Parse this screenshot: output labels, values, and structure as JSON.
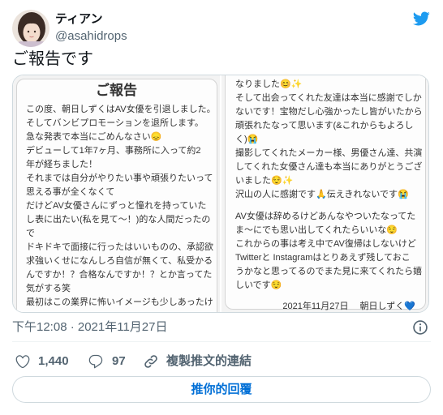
{
  "author": {
    "name": "ティアン",
    "handle": "@asahidrops"
  },
  "tweet": {
    "text": "ご報告です"
  },
  "media": {
    "left": {
      "title": "ご報告",
      "lines": [
        "この度、朝日しずくはAV女優を引退しました。",
        "そしてバンビプロモーションを退所します。",
        "急な発表で本当にごめんなさい😞",
        "デビューして1年7ヶ月、事務所に入って約2",
        "年が経ちました！",
        "それまでは自分がやりたい事や頑張りたいって",
        "思える事が全くなくて",
        "だけどAV女優さんにずっと憧れを持っていた",
        "し表に出たい(私を見て〜！)的な人間だったの",
        "で",
        "ドキドキで面接に行ったはいいものの、承認欲",
        "求強いくせになんしろ自信が無くて、私受かる",
        "んですか！？合格なんですか！？とか言ってた",
        "気がする笑",
        "最初はこの業界に怖いイメージも少しあったけ"
      ]
    },
    "right": {
      "lines": [
        "なりました😊✨",
        "そして出会ってくれた友達は本当に感謝でしか",
        "ないです！宝物だし心強かったし皆がいたから",
        "頑張れたなって思います(&これからもよろし",
        "く)😭",
        "撮影してくれたメーカー様、男優さん達、共演",
        "してくれた女優さん達も本当にありがとうござ",
        "いました😌✨",
        "沢山の人に感謝です🙏伝えきれないです😭",
        "AV女優は辞めるけどあんなやついたなってた",
        "ま〜にでも思い出してくれたらいいな😌",
        "これからの事は考え中でAV復帰はしないけど",
        "Twitterと Instagramはとりあえず残しておこ",
        "うかなと思ってるのでまた見に来てくれたら嬉",
        "しいです😌"
      ],
      "signature": {
        "date": "2021年11月27日",
        "name": "朝日しずく💙"
      }
    }
  },
  "meta": {
    "timestamp": "下午12:08 · 2021年11月27日"
  },
  "actions": {
    "like_count": "1,440",
    "reply_count": "97",
    "copy_link_label": "複製推文的連結"
  },
  "reply_button": {
    "label": "推你的回覆"
  },
  "icons": {
    "brand": "twitter-bird-icon",
    "info": "info-icon",
    "like": "heart-icon",
    "reply": "reply-icon",
    "copy_link": "link-icon"
  },
  "colors": {
    "accent": "#1d9bf0",
    "reply_button_text": "#006fd6",
    "text_primary": "#0f1419",
    "text_secondary": "#536471",
    "border": "#cfd9de"
  }
}
